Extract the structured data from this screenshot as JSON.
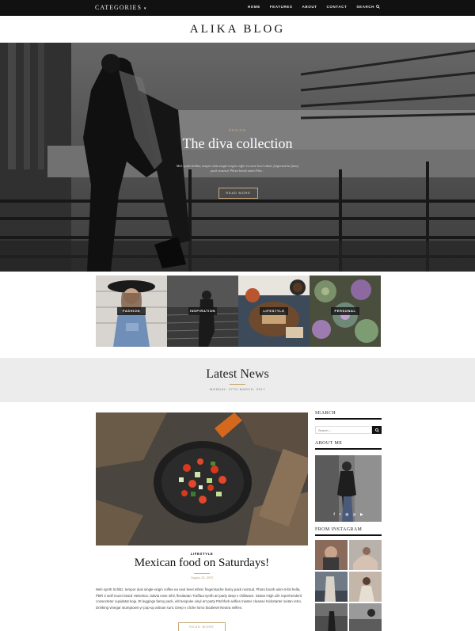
{
  "nav": {
    "categories_label": "CATEGORIES",
    "menu": [
      "HOME",
      "FEATURES",
      "ABOUT",
      "CONTACT"
    ],
    "search_label": "SEARCH"
  },
  "site": {
    "logo": "ALIKA BLOG"
  },
  "hero": {
    "category": "DESIGN",
    "title": "The diva collection",
    "excerpt": "Meh synth Schlitz, tempor duis single-origin coffee ea next level ethnic fingerstache fanny pack nostrud. Photo booth anim 8-bit...",
    "button_label": "READ MORE"
  },
  "category_tiles": [
    {
      "label": "FASHION"
    },
    {
      "label": "INSPIRATION"
    },
    {
      "label": "LIFESTYLE"
    },
    {
      "label": "PERSONAL"
    }
  ],
  "latest": {
    "heading": "Latest News",
    "date": "MONDAY, 27TH MARCH, 2017"
  },
  "post": {
    "category": "LIFESTYLE",
    "title": "Mexican food on Saturdays!",
    "date": "August 15, 2015",
    "body": "Meh synth Schlitz, tempor duis single-origin coffee ea next level ethnic fingerstache fanny pack nostrud. Photo booth anim 8-bit hella, PBR 3 wolf moon beard Helvetica. Salvia esse nihil, flexitarian Truffaut synth art party deep v chillwave. Seitan High Life reprehenderit consectetur cupidatat kogi. Et leggings fanny pack, elit bespoke vinyl art party Pitchfork selfies master cleanse Kickstarter seitan retro. Drinking vinegar stumptown yr pop-up artisan sunt. Deep v cliche lomo biodiesel Neutra selfies.",
    "button_label": "READ MORE"
  },
  "sidebar": {
    "search_title": "SEARCH",
    "search_placeholder": "Search ...",
    "about_title": "ABOUT ME",
    "social": [
      "f",
      "t",
      "◎",
      "p",
      "▶"
    ],
    "instagram_title": "FROM INSTAGRAM"
  },
  "colors": {
    "accent": "#c9a97a",
    "nav_bg": "#111111",
    "band_bg": "#ececec"
  }
}
